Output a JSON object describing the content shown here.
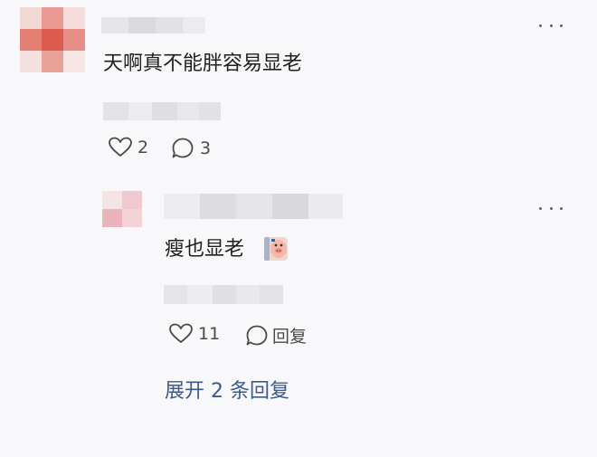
{
  "comments": [
    {
      "text": "天啊真不能胖容易显老",
      "likes": "2",
      "replies": "3"
    },
    {
      "text": "瘦也显老",
      "sticker_icon": "pig-emoji-sticker",
      "likes": "11",
      "reply_label": "回复"
    }
  ],
  "expand_label": "展开 2 条回复",
  "colors": {
    "background": "#f8f8fa",
    "link": "#3b5b8c",
    "text": "#1f1f1f",
    "muted": "#4a4a4a"
  }
}
